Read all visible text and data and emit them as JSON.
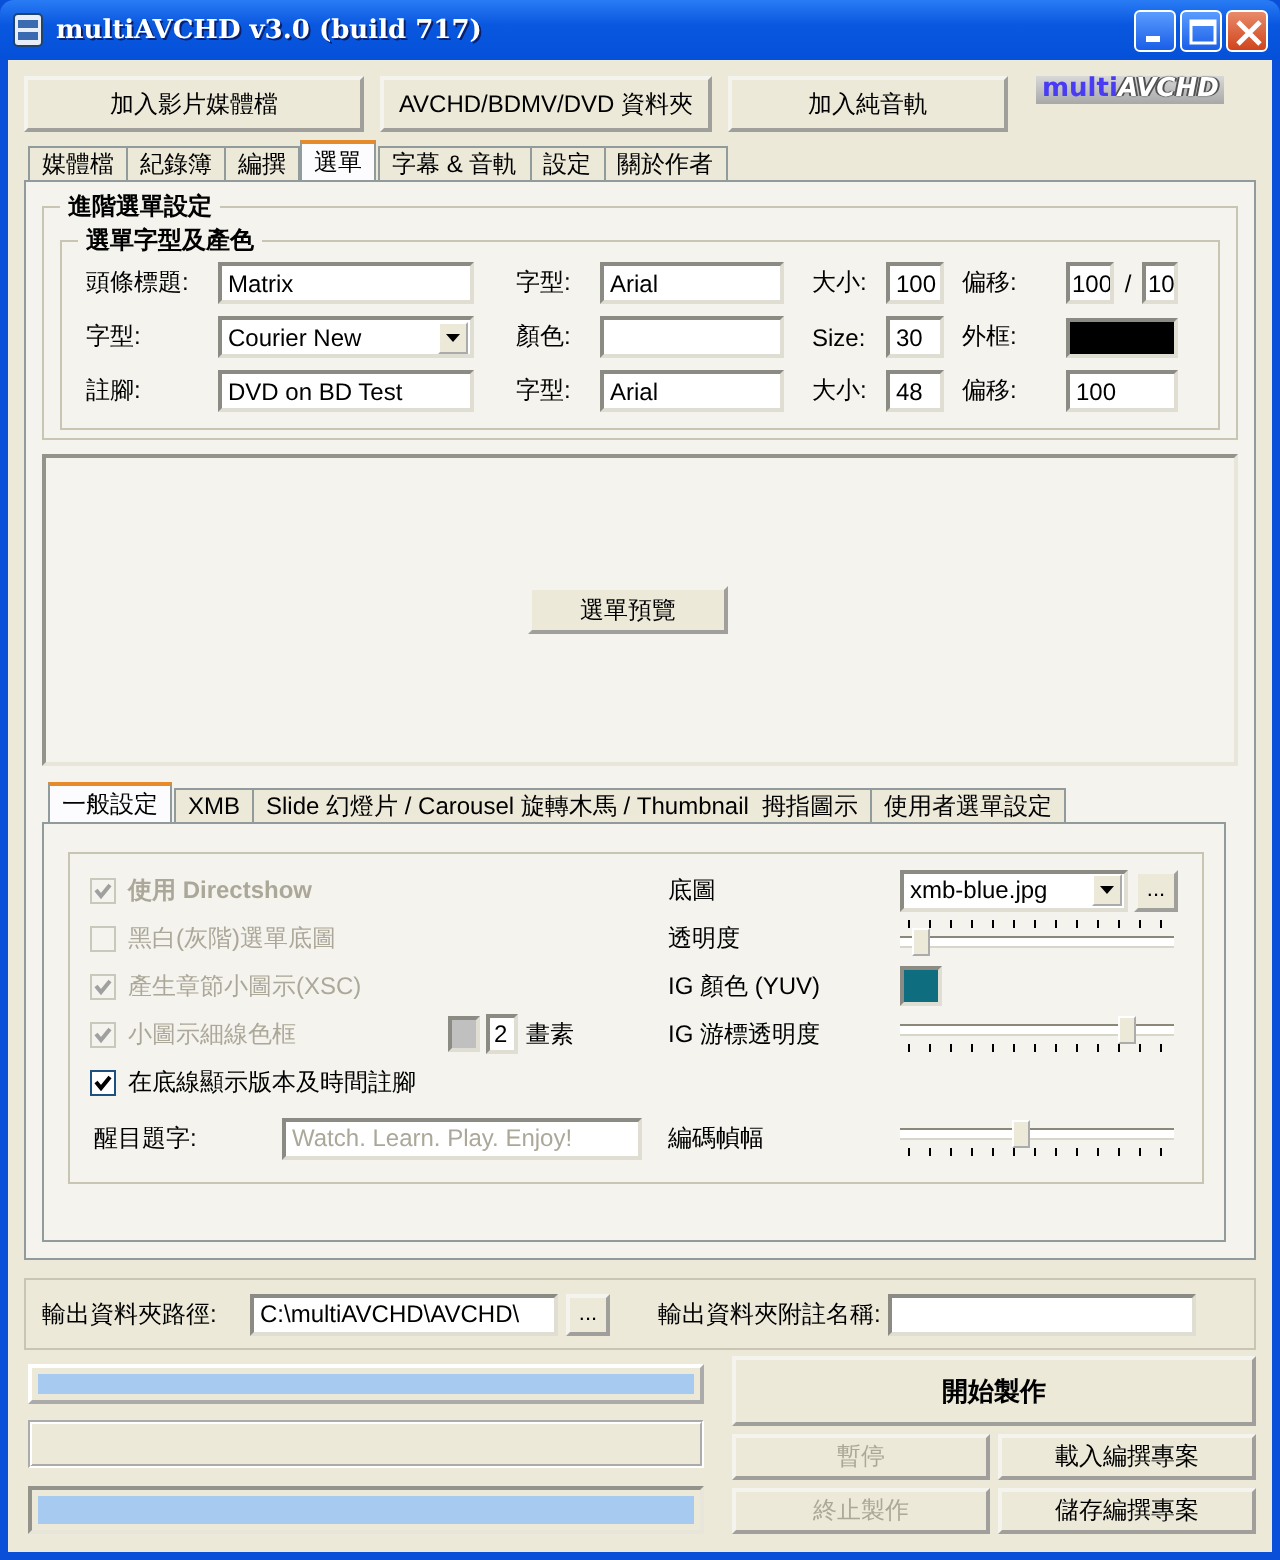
{
  "window": {
    "title": "multiAVCHD v3.0 (build 717)"
  },
  "toolbar": [
    {
      "label": "加入影片媒體檔"
    },
    {
      "label": "AVCHD/BDMV/DVD 資料夾"
    },
    {
      "label": "加入純音軌"
    }
  ],
  "logo": {
    "part_1": "multi",
    "part_2": "AVCHD"
  },
  "tabs": [
    {
      "label": "媒體檔",
      "selected": false
    },
    {
      "label": "紀錄簿",
      "selected": false
    },
    {
      "label": "編撰",
      "selected": false
    },
    {
      "label": "選單",
      "selected": true
    },
    {
      "label": "字幕 & 音軌",
      "selected": false
    },
    {
      "label": "設定",
      "selected": false
    },
    {
      "label": "關於作者",
      "selected": false
    }
  ],
  "advanced": {
    "title": "進階選單設定",
    "font_group": {
      "title": "選單字型及產色",
      "rows": [
        [
          {
            "kind": "text",
            "label": "頭條標題:",
            "value": "Matrix"
          },
          {
            "kind": "text",
            "label": "字型:",
            "value": "Arial"
          },
          {
            "kind": "text",
            "label": "大小:",
            "value": "100"
          },
          {
            "kind": "pair",
            "label": "偏移:",
            "values": [
              "100",
              "10"
            ],
            "separator": "/"
          }
        ],
        [
          {
            "kind": "combo",
            "label": "字型:",
            "value": "Courier New"
          },
          {
            "kind": "text",
            "label": "顏色:"
          },
          {
            "kind": "text",
            "label": "Size:",
            "value": "30"
          },
          {
            "kind": "swatch",
            "label": "外框:",
            "color": "#000000"
          }
        ],
        [
          {
            "kind": "text",
            "label": "註腳:",
            "value": "DVD on BD Test"
          },
          {
            "kind": "text",
            "label": "字型:",
            "value": "Arial"
          },
          {
            "kind": "text",
            "label": "大小:",
            "value": "48"
          },
          {
            "kind": "text",
            "label": "偏移:",
            "value": "100"
          }
        ]
      ]
    }
  },
  "preview_button": "選單預覽",
  "sub_tabs": [
    {
      "label": "一般設定",
      "selected": true
    },
    {
      "label": "XMB",
      "selected": false
    },
    {
      "label": "Slide 幻燈片 / Carousel 旋轉木馬 / Thumbnail  拇指圖示",
      "selected": false
    },
    {
      "label": "使用者選單設定",
      "selected": false
    }
  ],
  "general": {
    "options": [
      {
        "kind": "check",
        "label": "使用 Directshow",
        "checked": true,
        "disabled": true,
        "bold": true
      },
      {
        "kind": "check",
        "label": "黑白(灰階)選單底圖",
        "checked": false,
        "disabled": true,
        "bold": false
      },
      {
        "kind": "check",
        "label": "產生章節小圖示(XSC)",
        "checked": true,
        "disabled": true,
        "bold": false
      },
      {
        "kind": "check_width",
        "label": "小圖示細線色框",
        "checked": true,
        "disabled": true,
        "bold": false,
        "color": "#c0c0c0",
        "value": "2",
        "unit": "畫素"
      },
      {
        "kind": "check",
        "label": "在底線顯示版本及時間註腳",
        "checked": true,
        "disabled": false,
        "bold": false
      }
    ],
    "settings": [
      {
        "kind": "combo",
        "label": "底圖",
        "value": "xmb-blue.jpg",
        "button": "..."
      },
      {
        "kind": "slider_top",
        "label": "透明度",
        "level": 0.05
      },
      {
        "kind": "swatch",
        "label": "IG 顏色 (YUV)",
        "color": "#0e6e80"
      },
      {
        "kind": "slider",
        "label": "IG 游標透明度",
        "level": 0.86
      }
    ],
    "headline": {
      "label": "醒目題字:",
      "placeholder": "Watch. Learn. Play. Enjoy!"
    },
    "frame_slider": {
      "label": "編碼幀幅",
      "level": 0.44
    }
  },
  "output": {
    "path_label": "輸出資料夾路徑:",
    "path": "C:\\multiAVCHD\\AVCHD\\",
    "browse": "...",
    "suffix_label": "輸出資料夾附註名稱:"
  },
  "progress_top": {
    "level": 1
  },
  "progress_bottom": {
    "level": 1
  },
  "actions": [
    {
      "label": "開始製作",
      "kind": "primary",
      "disabled": false
    },
    {
      "label": "暫停",
      "kind": "small",
      "disabled": true
    },
    {
      "label": "載入編撰專案",
      "kind": "small",
      "disabled": false
    },
    {
      "label": "終止製作",
      "kind": "small",
      "disabled": true
    },
    {
      "label": "儲存編撰專案",
      "kind": "small",
      "disabled": false
    }
  ]
}
